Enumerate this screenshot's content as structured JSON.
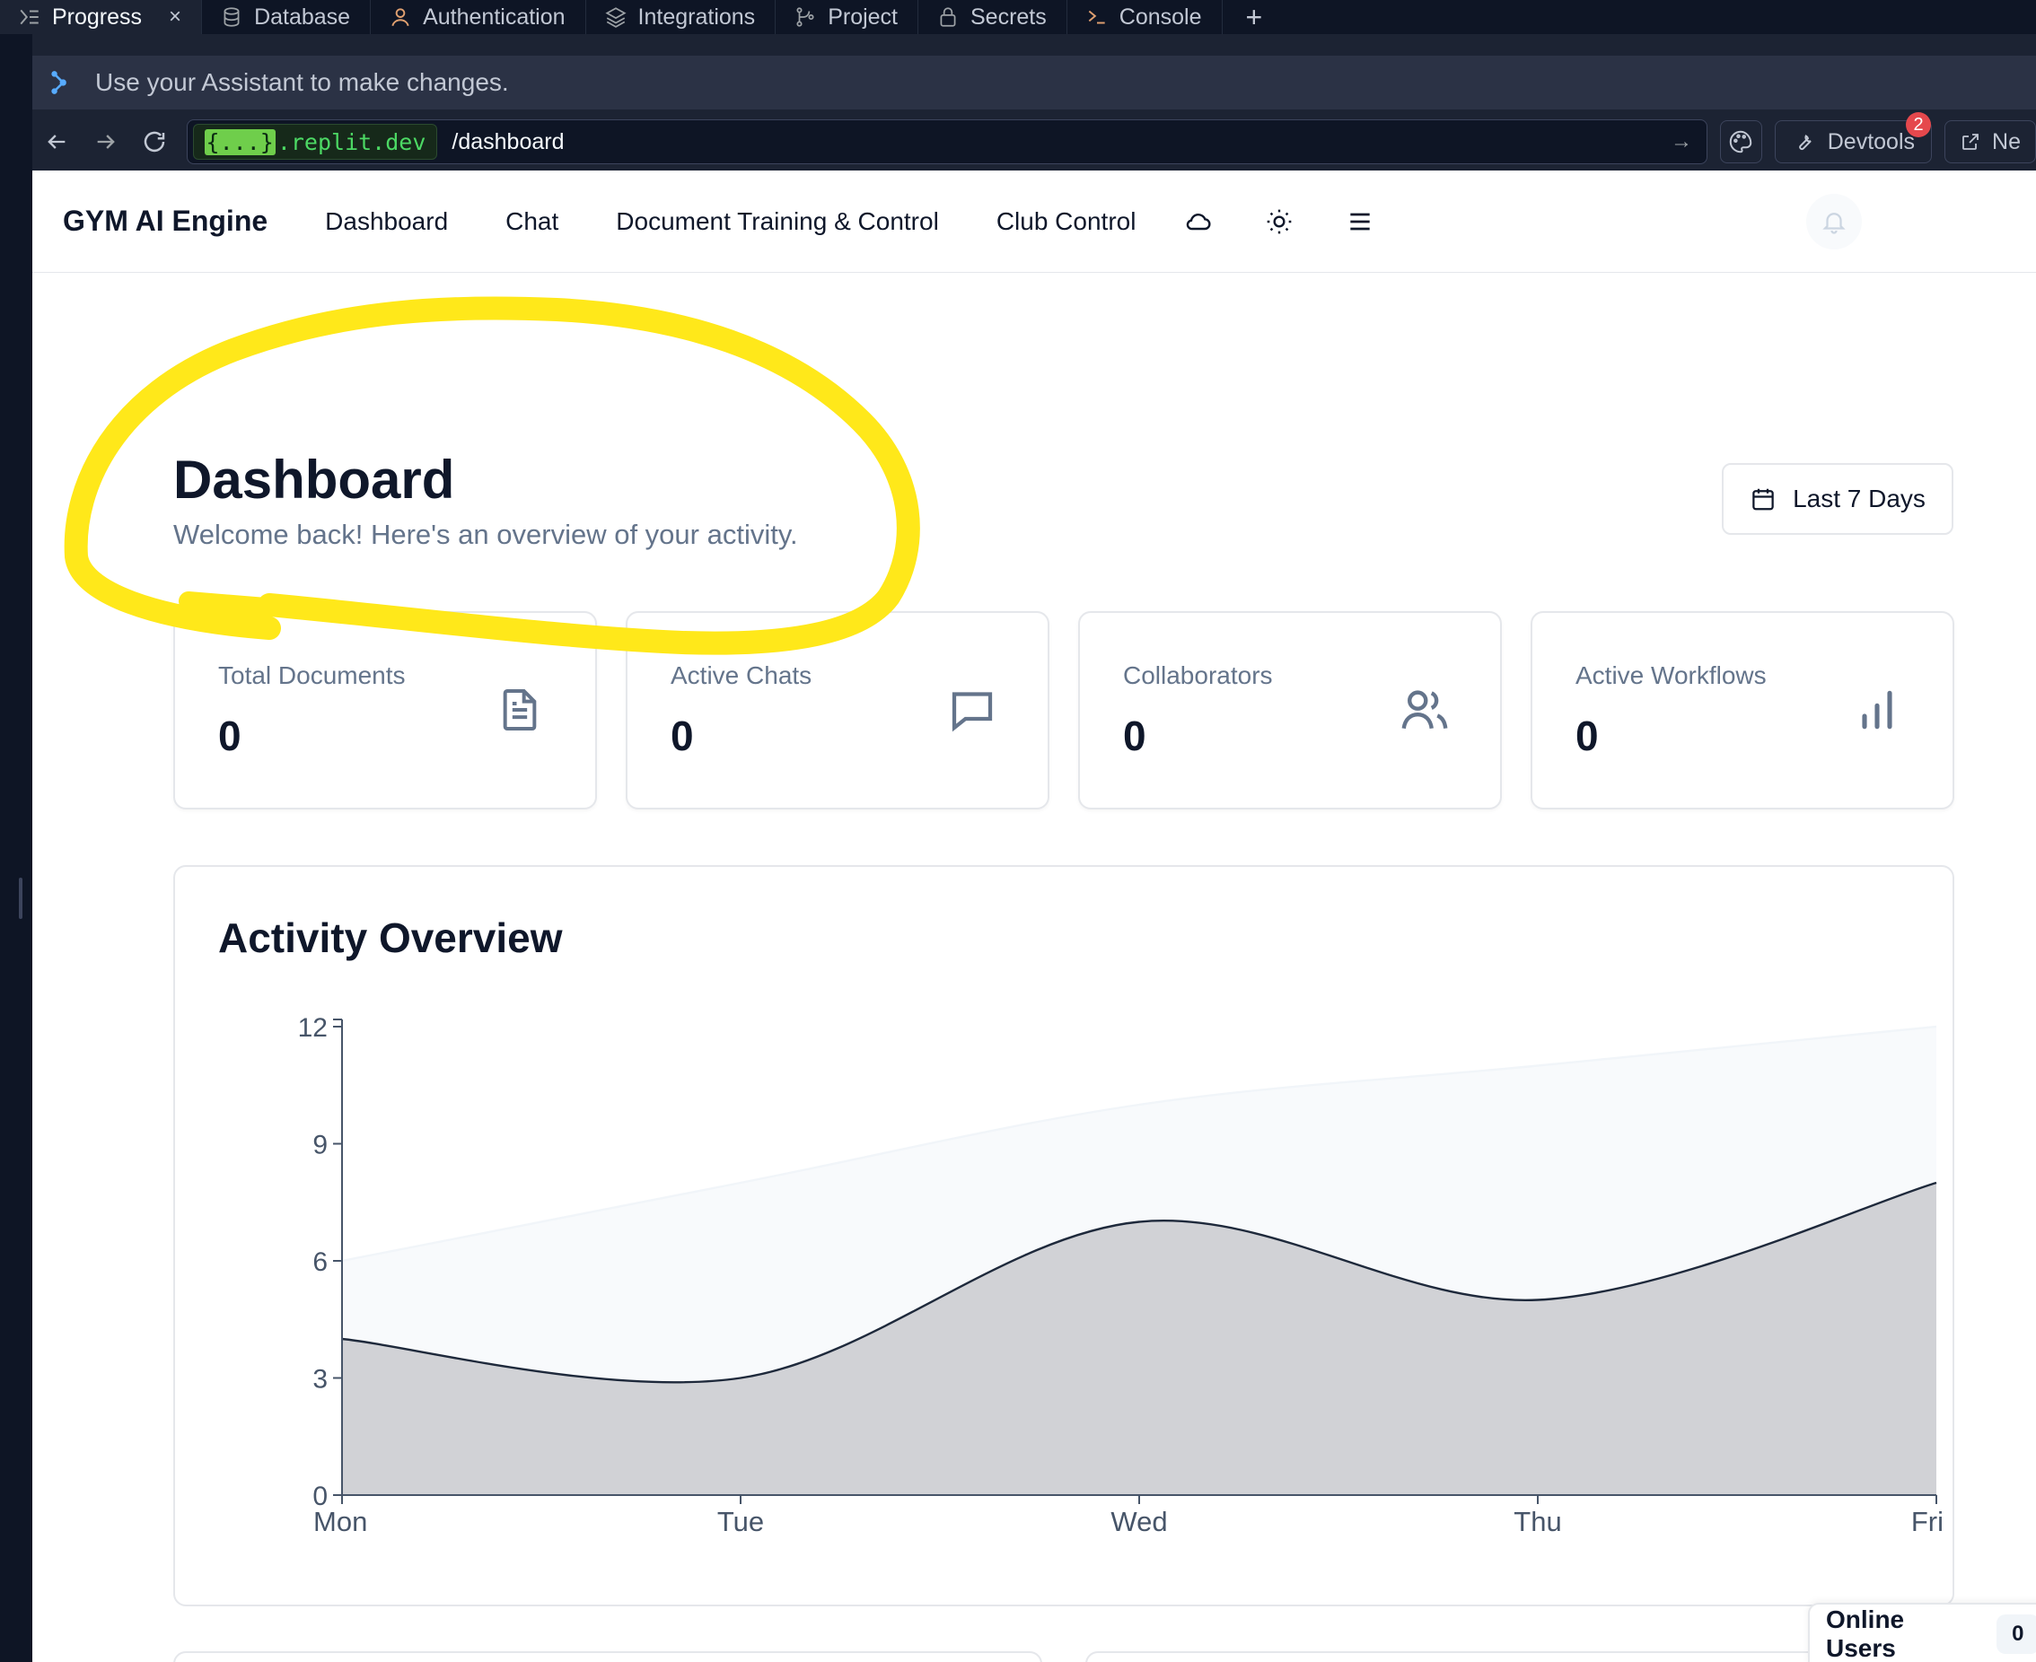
{
  "ide_tabs": [
    {
      "label": "Progress",
      "icon": "progress-icon",
      "active": true
    },
    {
      "label": "Database",
      "icon": "database-icon"
    },
    {
      "label": "Authentication",
      "icon": "user-icon"
    },
    {
      "label": "Integrations",
      "icon": "layers-icon"
    },
    {
      "label": "Project",
      "icon": "git-branch-icon"
    },
    {
      "label": "Secrets",
      "icon": "lock-icon"
    },
    {
      "label": "Console",
      "icon": "terminal-icon"
    }
  ],
  "new_tab_label": "+",
  "tab_close_label": "×",
  "assistant_hint": "Use your Assistant to make changes.",
  "browser": {
    "domain_brace": "{...}",
    "domain": ".replit.dev",
    "path": "/dashboard",
    "devtools_label": "Devtools",
    "devtools_badge": "2",
    "newtab_label": "Ne"
  },
  "app": {
    "brand": "GYM AI Engine",
    "nav_links": [
      "Dashboard",
      "Chat",
      "Document Training & Control",
      "Club Control"
    ],
    "nav_icons": [
      "cloud-icon",
      "sun-icon",
      "menu-icon"
    ]
  },
  "page": {
    "title": "Dashboard",
    "subtitle": "Welcome back! Here's an overview of your activity.",
    "date_range": "Last 7 Days"
  },
  "stats": [
    {
      "label": "Total Documents",
      "value": "0",
      "icon": "document-icon"
    },
    {
      "label": "Active Chats",
      "value": "0",
      "icon": "message-icon"
    },
    {
      "label": "Collaborators",
      "value": "0",
      "icon": "users-icon"
    },
    {
      "label": "Active Workflows",
      "value": "0",
      "icon": "bar-chart-icon"
    }
  ],
  "chart_title": "Activity Overview",
  "chart_data": {
    "type": "area",
    "title": "Activity Overview",
    "categories": [
      "Mon",
      "Tue",
      "Wed",
      "Thu",
      "Fri"
    ],
    "series": [
      {
        "values": [
          4,
          3,
          7,
          5,
          8
        ],
        "color": "#d1d2d6",
        "stroke": "#1e293b"
      },
      {
        "values": [
          6,
          8,
          10,
          11,
          12
        ],
        "color": "#f8fafc",
        "stroke": "#f1f5f9"
      }
    ],
    "yticks": [
      0,
      3,
      6,
      9,
      12
    ],
    "ylim": [
      0,
      12
    ],
    "grid": false
  },
  "online_users": {
    "label": "Online Users",
    "count": "0"
  },
  "annotation": {
    "color": "#ffe81a"
  }
}
